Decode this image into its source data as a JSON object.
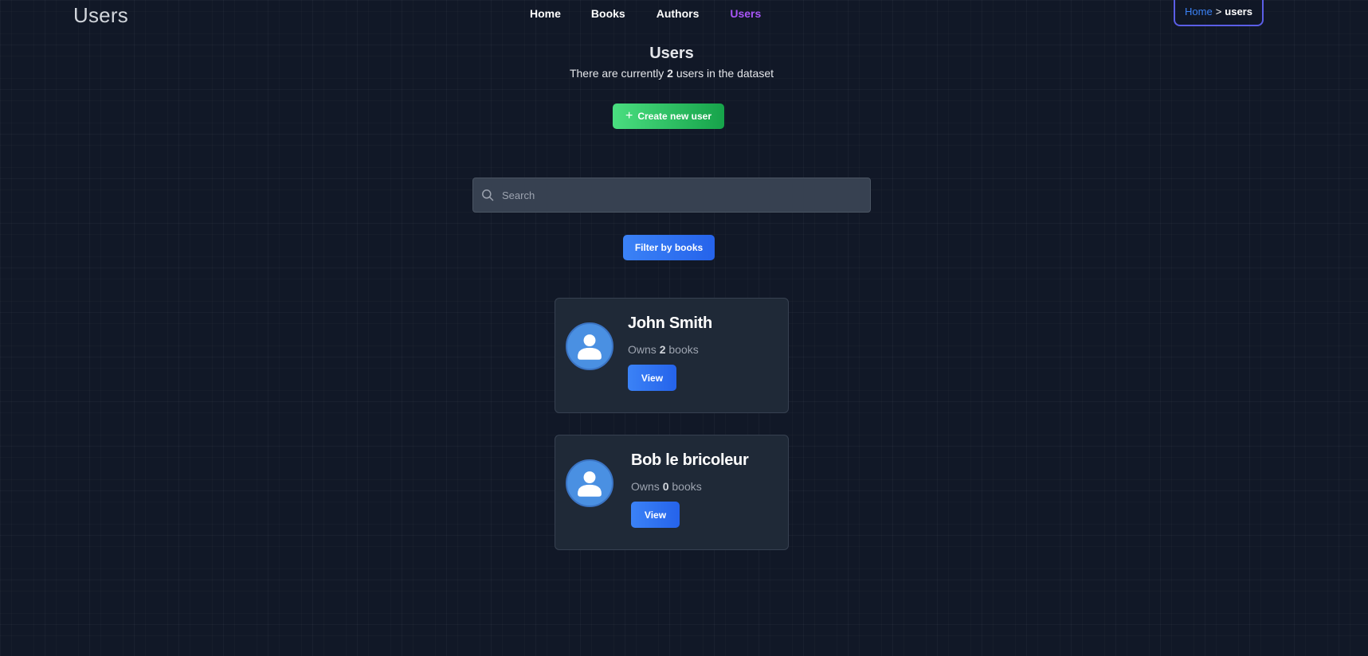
{
  "header": {
    "brand_title": "Users",
    "nav": [
      {
        "label": "Home",
        "active": false
      },
      {
        "label": "Books",
        "active": false
      },
      {
        "label": "Authors",
        "active": false
      },
      {
        "label": "Users",
        "active": true
      }
    ],
    "breadcrumb": {
      "home": "Home",
      "separator": ">",
      "current": "users"
    }
  },
  "main": {
    "title": "Users",
    "subtitle_prefix": "There are currently",
    "user_count": "2",
    "subtitle_suffix": "users in the dataset",
    "create_button": {
      "icon": "plus-icon",
      "label": "Create new user"
    },
    "search": {
      "placeholder": "Search",
      "value": "",
      "icon": "search-icon"
    },
    "filter_button": {
      "label": "Filter by books"
    }
  },
  "users": [
    {
      "name": "John Smith",
      "owns_prefix": "Owns",
      "book_count": "2",
      "owns_suffix": "books",
      "view_label": "View",
      "avatar_icon": "user-avatar-icon"
    },
    {
      "name": "Bob le bricoleur",
      "owns_prefix": "Owns",
      "book_count": "0",
      "owns_suffix": "books",
      "view_label": "View",
      "avatar_icon": "user-avatar-icon"
    }
  ],
  "colors": {
    "background": "#111827",
    "card": "#1f2937",
    "nav_active": "#a855f7",
    "create_button": "#22c55e",
    "primary_button": "#2563eb",
    "avatar": "#4a90e2",
    "breadcrumb_border": "#5b5ee6"
  }
}
